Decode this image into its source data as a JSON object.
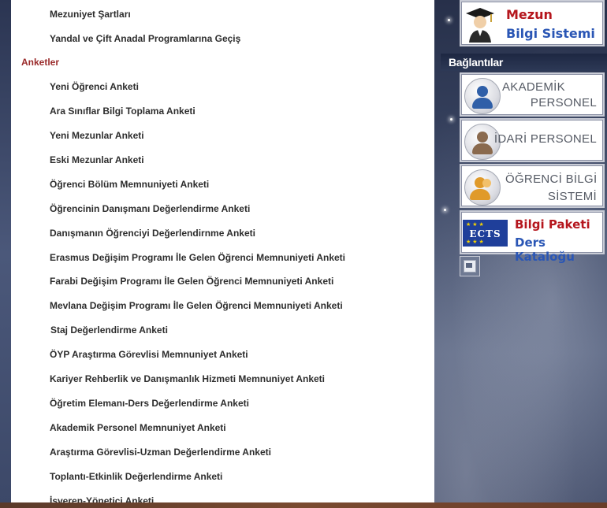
{
  "menu": {
    "items_top": [
      "Mezuniyet Şartları",
      "Yandal ve Çift Anadal Programlarına Geçiş"
    ],
    "section_title": "Anketler",
    "survey_items": [
      "Yeni Öğrenci Anketi",
      "Ara Sınıflar Bilgi Toplama Anketi",
      "Yeni Mezunlar Anketi",
      "Eski Mezunlar Anketi",
      "Öğrenci Bölüm Memnuniyeti Anketi",
      "Öğrencinin Danışmanı Değerlendirme Anketi",
      "Danışmanın Öğrenciyi Değerlendirnme Anketi",
      "Erasmus Değişim Programı İle Gelen Öğrenci Memnuniyeti Anketi",
      "Farabi Değişim Programı İle Gelen Öğrenci Memnuniyeti Anketi",
      "Mevlana Değişim Programı İle Gelen Öğrenci Memnuniyeti Anketi",
      "Staj Değerlendirme Anketi",
      "ÖYP Araştırma Görevlisi Memnuniyet Anketi",
      "Kariyer Rehberlik ve Danışmanlık Hizmeti Memnuniyet Anketi",
      "Öğretim Elemanı-Ders Değerlendirme Anketi",
      "Akademik Personel Memnuniyet Anketi",
      "Araştırma Görevlisi-Uzman Değerlendirme Anketi",
      "Toplantı-Etkinlik Değerlendirme Anketi",
      "İşveren-Yönetici Anketi"
    ]
  },
  "sidebar": {
    "mezun": {
      "line1": "Mezun",
      "line2": "Bilgi Sistemi"
    },
    "links_title": "Bağlantılar",
    "akademik": {
      "line1": "AKADEMİK",
      "line2": "PERSONEL"
    },
    "idari": {
      "line1": "İDARİ PERSONEL"
    },
    "ogrenci": {
      "line1": "ÖĞRENCİ BİLGİ",
      "line2": "SİSTEMİ"
    },
    "ects": {
      "logo": "ECTS",
      "line1": "Bilgi Paketi",
      "line2": "Ders Kataloğu"
    }
  },
  "colors": {
    "section_title": "#9a2a2a",
    "mezun_red": "#b5161d",
    "mezun_blue": "#2a56b5",
    "akademik_person": "#2f5fa8",
    "idari_person": "#8a6a4e",
    "ogrenci_person": "#e09a2a"
  },
  "icons": {
    "mezun": "graduate-icon",
    "akademik": "person-blue-icon",
    "idari": "person-brown-icon",
    "ogrenci": "person-group-icon",
    "ects": "eu-stars-icon",
    "small_button": "image-icon"
  }
}
